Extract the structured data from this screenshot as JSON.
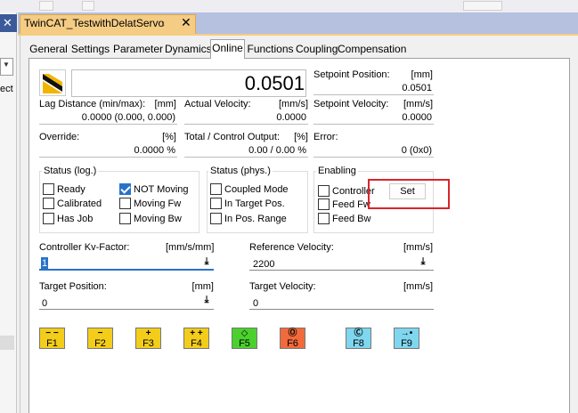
{
  "doc_tab": {
    "title": "TwinCAT_TestwithDelatServo",
    "pin": "⭭",
    "close": "✕"
  },
  "left_pane": {
    "close": "✕",
    "text": "ect"
  },
  "tabs": [
    "General",
    "Settings",
    "Parameter",
    "Dynamics",
    "Online",
    "Functions",
    "Coupling",
    "Compensation"
  ],
  "active_tab": "Online",
  "position": {
    "value": "0.0501"
  },
  "setpoint_position": {
    "label": "Setpoint Position:",
    "unit": "[mm]",
    "value": "0.0501"
  },
  "lag_distance": {
    "label": "Lag Distance (min/max):",
    "unit": "[mm]",
    "value": "0.0000  (0.000, 0.000)"
  },
  "actual_velocity": {
    "label": "Actual Velocity:",
    "unit": "[mm/s]",
    "value": "0.0000"
  },
  "setpoint_velocity": {
    "label": "Setpoint Velocity:",
    "unit": "[mm/s]",
    "value": "0.0000"
  },
  "override": {
    "label": "Override:",
    "unit": "[%]",
    "value": "0.0000 %"
  },
  "total_output": {
    "label": "Total / Control Output:",
    "unit": "[%]",
    "value": "0.00 /  0.00 %"
  },
  "error": {
    "label": "Error:",
    "value": "0 (0x0)"
  },
  "status_log": {
    "title": "Status (log.)",
    "items": [
      {
        "label": "Ready",
        "checked": false
      },
      {
        "label": "NOT Moving",
        "checked": true
      },
      {
        "label": "Calibrated",
        "checked": false
      },
      {
        "label": "Moving Fw",
        "checked": false
      },
      {
        "label": "Has Job",
        "checked": false
      },
      {
        "label": "Moving Bw",
        "checked": false
      }
    ]
  },
  "status_phys": {
    "title": "Status (phys.)",
    "items": [
      {
        "label": "Coupled Mode",
        "checked": false
      },
      {
        "label": "In Target Pos.",
        "checked": false
      },
      {
        "label": "In Pos. Range",
        "checked": false
      }
    ]
  },
  "enabling": {
    "title": "Enabling",
    "items": [
      {
        "label": "Controller",
        "checked": false
      },
      {
        "label": "Feed Fw",
        "checked": false
      },
      {
        "label": "Feed Bw",
        "checked": false
      }
    ],
    "set_label": "Set"
  },
  "controller_kv": {
    "label": "Controller Kv-Factor:",
    "unit": "[mm/s/mm]",
    "value": "1"
  },
  "reference_velocity": {
    "label": "Reference Velocity:",
    "unit": "[mm/s]",
    "value": "2200"
  },
  "target_position": {
    "label": "Target Position:",
    "unit": "[mm]",
    "value": "0"
  },
  "target_velocity": {
    "label": "Target Velocity:",
    "unit": "[mm/s]",
    "value": "0"
  },
  "download_symbol": "⤓",
  "function_keys": [
    {
      "symbol": "− −",
      "key": "F1",
      "color": "#f3cd1a"
    },
    {
      "symbol": "−",
      "key": "F2",
      "color": "#f3cd1a"
    },
    {
      "symbol": "+",
      "key": "F3",
      "color": "#f3cd1a"
    },
    {
      "symbol": "+ +",
      "key": "F4",
      "color": "#f3cd1a"
    },
    {
      "symbol": "◇",
      "key": "F5",
      "color": "#4bd12e"
    },
    {
      "symbol": "Ⓞ",
      "key": "F6",
      "color": "#f26a3c"
    },
    {
      "symbol": "Ⓒ",
      "key": "F8",
      "color": "#7fd7ef"
    },
    {
      "symbol": "→•",
      "key": "F9",
      "color": "#7fd7ef"
    }
  ]
}
